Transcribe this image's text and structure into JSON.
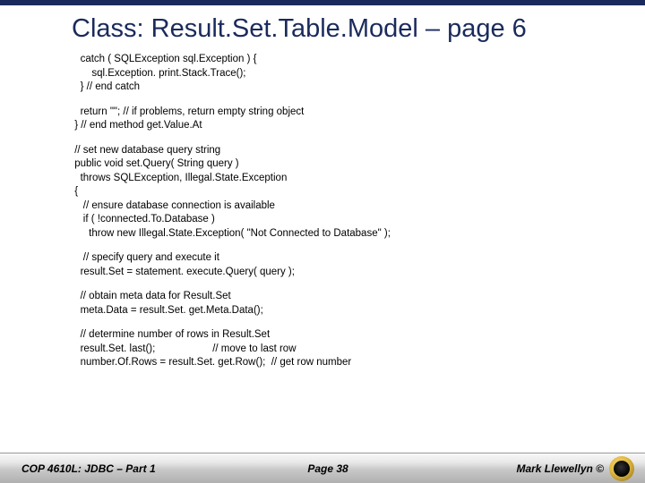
{
  "title": "Class:  Result.Set.Table.Model – page 6",
  "code": {
    "b1": "   catch ( SQLException sql.Exception ) {\n       sql.Exception. print.Stack.Trace();\n   } // end catch",
    "b2": "   return \"\"; // if problems, return empty string object\n } // end method get.Value.At",
    "b3": " // set new database query string\n public void set.Query( String query )\n   throws SQLException, Illegal.State.Exception\n {\n    // ensure database connection is available\n    if ( !connected.To.Database )\n      throw new Illegal.State.Exception( \"Not Connected to Database\" );",
    "b4": "    // specify query and execute it\n   result.Set = statement. execute.Query( query );",
    "b5": "   // obtain meta data for Result.Set\n   meta.Data = result.Set. get.Meta.Data();",
    "b6": "   // determine number of rows in Result.Set\n   result.Set. last();                    // move to last row\n   number.Of.Rows = result.Set. get.Row();  // get row number"
  },
  "footer": {
    "left": "COP 4610L: JDBC – Part 1",
    "center": "Page 38",
    "right": "Mark Llewellyn ©"
  }
}
